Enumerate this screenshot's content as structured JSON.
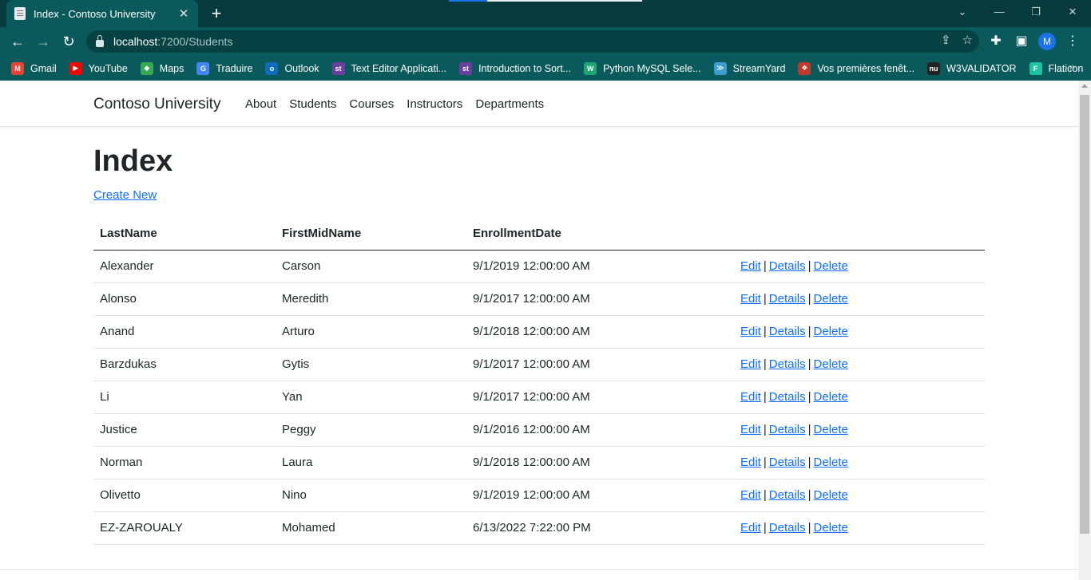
{
  "browser": {
    "tab_title": "Index - Contoso University",
    "tab_close": "✕",
    "new_tab": "+",
    "url_host": "localhost",
    "url_path": ":7200/Students",
    "profile_initial": "M",
    "window_controls": [
      "⌄",
      "—",
      "❐",
      "✕"
    ],
    "bookmarks": [
      {
        "label": "Gmail",
        "icon": "gmail-icon",
        "color": "#ea4335",
        "glyph": "M"
      },
      {
        "label": "YouTube",
        "icon": "youtube-icon",
        "color": "#ff0000",
        "glyph": "▶"
      },
      {
        "label": "Maps",
        "icon": "maps-icon",
        "color": "#34a853",
        "glyph": "◆"
      },
      {
        "label": "Traduire",
        "icon": "translate-icon",
        "color": "#4285f4",
        "glyph": "G"
      },
      {
        "label": "Outlook",
        "icon": "outlook-icon",
        "color": "#0f6cbd",
        "glyph": "o"
      },
      {
        "label": "Text Editor Applicati...",
        "icon": "studytonight-icon",
        "color": "#6a3fa0",
        "glyph": "st"
      },
      {
        "label": "Introduction to Sort...",
        "icon": "studytonight-icon",
        "color": "#6a3fa0",
        "glyph": "st"
      },
      {
        "label": "Python MySQL Sele...",
        "icon": "w3resource-icon",
        "color": "#1ba672",
        "glyph": "W"
      },
      {
        "label": "StreamYard",
        "icon": "streamyard-icon",
        "color": "#3c9dd0",
        "glyph": "≫"
      },
      {
        "label": "Vos premières fenêt...",
        "icon": "bookmark-icon",
        "color": "#c0392b",
        "glyph": "❖"
      },
      {
        "label": "W3VALIDATOR",
        "icon": "w3validator-icon",
        "color": "#222222",
        "glyph": "nu"
      },
      {
        "label": "Flaticon",
        "icon": "flaticon-icon",
        "color": "#1ec29f",
        "glyph": "F"
      }
    ],
    "bookmarks_more": "»"
  },
  "site": {
    "brand": "Contoso University",
    "nav": [
      "About",
      "Students",
      "Courses",
      "Instructors",
      "Departments"
    ]
  },
  "page": {
    "title": "Index",
    "create_new": "Create New"
  },
  "table": {
    "headers": [
      "LastName",
      "FirstMidName",
      "EnrollmentDate",
      ""
    ],
    "action_labels": {
      "edit": "Edit",
      "details": "Details",
      "delete": "Delete",
      "separator": "|"
    },
    "rows": [
      {
        "last": "Alexander",
        "first": "Carson",
        "date": "9/1/2019 12:00:00 AM"
      },
      {
        "last": "Alonso",
        "first": "Meredith",
        "date": "9/1/2017 12:00:00 AM"
      },
      {
        "last": "Anand",
        "first": "Arturo",
        "date": "9/1/2018 12:00:00 AM"
      },
      {
        "last": "Barzdukas",
        "first": "Gytis",
        "date": "9/1/2017 12:00:00 AM"
      },
      {
        "last": "Li",
        "first": "Yan",
        "date": "9/1/2017 12:00:00 AM"
      },
      {
        "last": "Justice",
        "first": "Peggy",
        "date": "9/1/2016 12:00:00 AM"
      },
      {
        "last": "Norman",
        "first": "Laura",
        "date": "9/1/2018 12:00:00 AM"
      },
      {
        "last": "Olivetto",
        "first": "Nino",
        "date": "9/1/2019 12:00:00 AM"
      },
      {
        "last": "EZ-ZAROUALY",
        "first": "Mohamed",
        "date": "6/13/2022 7:22:00 PM"
      }
    ]
  },
  "colors": {
    "chrome_dark": "#063a3d",
    "chrome": "#0b5a5b",
    "link": "#0d6efd",
    "text": "#212529"
  }
}
